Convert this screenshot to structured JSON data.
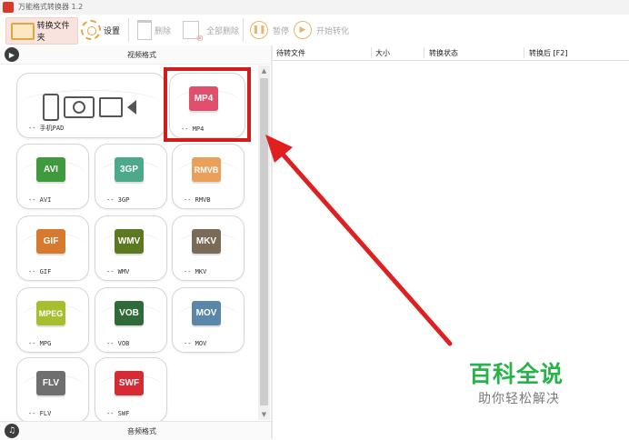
{
  "window": {
    "title": "万能格式转换器 1.2"
  },
  "toolbar": {
    "convert_folder": "转换文件夹",
    "settings": "设置",
    "delete": "删除",
    "delete_all": "全部删除",
    "pause": "暂停",
    "start_convert": "开始转化"
  },
  "left_panel": {
    "video_header": "视频格式",
    "audio_footer": "音频格式",
    "tiles": {
      "phone_pad": "-- 手机PAD",
      "mp4": {
        "badge": "MP4",
        "label": "-- MP4",
        "color": "#e0506c"
      },
      "avi": {
        "badge": "AVI",
        "label": "-- AVI",
        "color": "#3e9a3c"
      },
      "3gp": {
        "badge": "3GP",
        "label": "-- 3GP",
        "color": "#4caa8a"
      },
      "rmvb": {
        "badge": "RMVB",
        "label": "-- RMVB",
        "color": "#eba05a"
      },
      "gif": {
        "badge": "GIF",
        "label": "-- GIF",
        "color": "#d67a2f"
      },
      "wmv": {
        "badge": "WMV",
        "label": "-- WMV",
        "color": "#5b7a1f"
      },
      "mkv": {
        "badge": "MKV",
        "label": "-- MKV",
        "color": "#7a6a58"
      },
      "mpeg": {
        "badge": "MPEG",
        "label": "-- MPG",
        "color": "#a7bf2e"
      },
      "vob": {
        "badge": "VOB",
        "label": "-- VOB",
        "color": "#2e6b39"
      },
      "mov": {
        "badge": "MOV",
        "label": "-- MOV",
        "color": "#5a86a8"
      },
      "flv": {
        "badge": "FLV",
        "label": "-- FLV",
        "color": "#6f6f6f"
      },
      "swf": {
        "badge": "SWF",
        "label": "-- SWF",
        "color": "#d62b33"
      }
    }
  },
  "file_table": {
    "columns": [
      "待转文件",
      "大小",
      "转换状态",
      "转换后 [F2]"
    ]
  },
  "watermark": {
    "title": "百科全说",
    "subtitle": "助你轻松解决"
  },
  "colors": {
    "highlight": "#d21b1b",
    "arrow": "#e02020",
    "watermark": "#27b34a"
  }
}
